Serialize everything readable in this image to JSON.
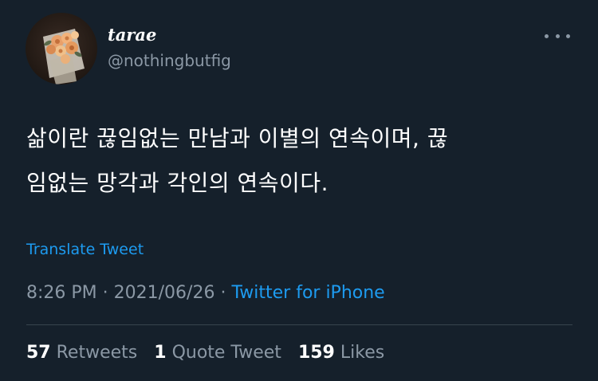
{
  "author": {
    "display_name": "tarae",
    "handle": "@nothingbutfig",
    "avatar_icon": "bouquet-avatar"
  },
  "tweet": {
    "text_line_1": "삶이란 끊임없는 만남과 이별의 연속이며, 끊",
    "text_line_2": "임없는 망각과 각인의 연속이다.",
    "translate_label": "Translate Tweet",
    "time": "8:26 PM",
    "date": "2021/06/26",
    "separator": "·",
    "source": "Twitter for iPhone"
  },
  "stats": {
    "retweets_count": "57",
    "retweets_label": "Retweets",
    "quote_count": "1",
    "quote_label": "Quote Tweet",
    "likes_count": "159",
    "likes_label": "Likes"
  },
  "icons": {
    "more": "more-options-icon"
  },
  "colors": {
    "background": "#15202b",
    "link": "#1d9bf0",
    "muted": "#8b98a5",
    "divider": "#38444d"
  }
}
